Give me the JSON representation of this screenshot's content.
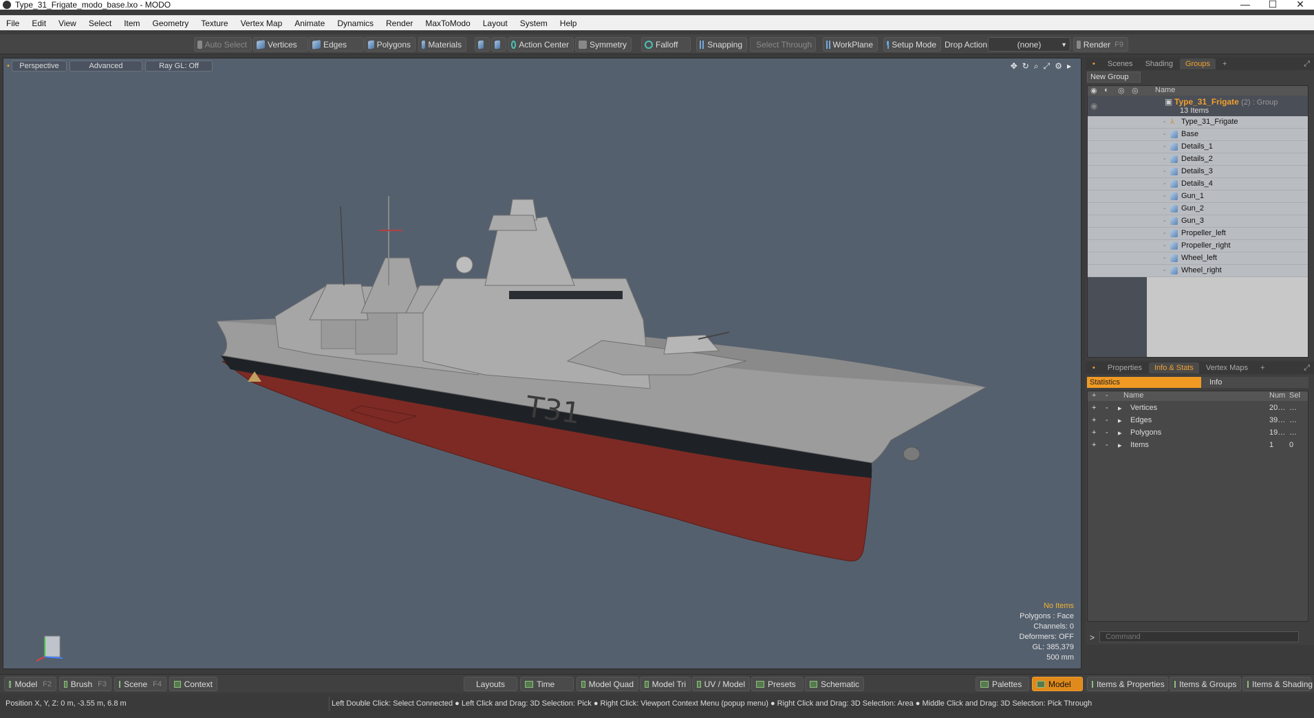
{
  "window": {
    "title": "Type_31_Frigate_modo_base.lxo - MODO",
    "controls": {
      "minimize": "—",
      "maximize": "☐",
      "close": "✕"
    }
  },
  "menu": [
    "File",
    "Edit",
    "View",
    "Select",
    "Item",
    "Geometry",
    "Texture",
    "Vertex Map",
    "Animate",
    "Dynamics",
    "Render",
    "MaxToModo",
    "Layout",
    "System",
    "Help"
  ],
  "toolbar": {
    "auto_select": "Auto Select",
    "vertices": "Vertices",
    "edges": "Edges",
    "polygons": "Polygons",
    "materials": "Materials",
    "action_center": "Action Center",
    "symmetry": "Symmetry",
    "falloff": "Falloff",
    "snapping": "Snapping",
    "select_through": "Select Through",
    "workplane": "WorkPlane",
    "setup_mode": "Setup Mode",
    "drop_action_label": "Drop Action",
    "drop_action_value": "(none)",
    "render": "Render",
    "render_key": "F9"
  },
  "viewport": {
    "tab_perspective": "Perspective",
    "tab_advanced": "Advanced",
    "tab_raygl": "Ray GL: Off",
    "info": {
      "selection": "No Items",
      "polygons": "Polygons : Face",
      "channels": "Channels: 0",
      "deformers": "Deformers: OFF",
      "gl": "GL: 385,379",
      "scale": "500 mm"
    },
    "hull_text": "T31",
    "axis_colors": {
      "x": "#e04040",
      "y": "#40c040",
      "z": "#4080ff"
    }
  },
  "groups_panel": {
    "tabs": [
      "Scenes",
      "Shading",
      "Groups"
    ],
    "active_tab": "Groups",
    "new_group": "New Group",
    "column_name": "Name",
    "group": {
      "name": "Type_31_Frigate",
      "meta": "(2) : Group",
      "count": "13 Items"
    },
    "items": [
      "Type_31_Frigate",
      "Base",
      "Details_1",
      "Details_2",
      "Details_3",
      "Details_4",
      "Gun_1",
      "Gun_2",
      "Gun_3",
      "Propeller_left",
      "Propeller_right",
      "Wheel_left",
      "Wheel_right"
    ]
  },
  "stats_panel": {
    "tabs": [
      "Properties",
      "Info & Stats",
      "Vertex Maps"
    ],
    "active_tab": "Info & Stats",
    "sub_tabs": [
      "Statistics",
      "Info"
    ],
    "columns": {
      "name": "Name",
      "num": "Num",
      "sel": "Sel"
    },
    "rows": [
      {
        "name": "Vertices",
        "num": "20…",
        "sel": "…"
      },
      {
        "name": "Edges",
        "num": "39…",
        "sel": "…"
      },
      {
        "name": "Polygons",
        "num": "19…",
        "sel": "…"
      },
      {
        "name": "Items",
        "num": "1",
        "sel": "0"
      }
    ],
    "command_placeholder": "Command"
  },
  "modebar": {
    "model": "Model",
    "model_key": "F2",
    "brush": "Brush",
    "brush_key": "F3",
    "scene": "Scene",
    "scene_key": "F4",
    "context": "Context",
    "layouts": "Layouts",
    "time": "Time",
    "model_quad": "Model Quad",
    "model_tri": "Model Tri",
    "uv_model": "UV / Model",
    "presets": "Presets",
    "schematic": "Schematic",
    "palettes": "Palettes",
    "model_active": "Model",
    "items_properties": "Items & Properties",
    "items_groups": "Items & Groups",
    "items_shading": "Items & Shading"
  },
  "status": {
    "position": "Position X, Y, Z:   0 m, -3.55 m, 6.8 m",
    "hint": "Left Double Click: Select Connected ● Left Click and Drag: 3D Selection: Pick ● Right Click: Viewport Context Menu (popup menu) ● Right Click and Drag: 3D Selection: Area ● Middle Click and Drag: 3D Selection: Pick Through"
  }
}
